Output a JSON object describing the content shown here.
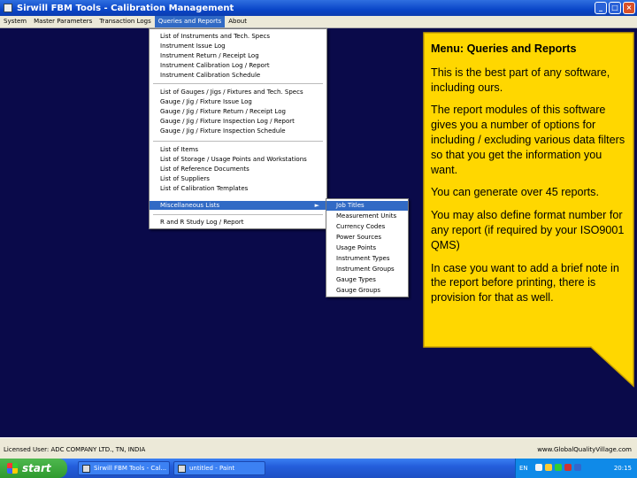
{
  "window": {
    "title": "Sirwill FBM Tools - Calibration Management",
    "minimize_label": "_",
    "maximize_label": "□",
    "close_label": "×"
  },
  "menubar": [
    {
      "label": "System"
    },
    {
      "label": "Master Parameters"
    },
    {
      "label": "Transaction Logs"
    },
    {
      "label": "Queries and Reports"
    },
    {
      "label": "About"
    }
  ],
  "queries_menu": {
    "items": [
      {
        "label": "List of Instruments and Tech. Specs"
      },
      {
        "label": "Instrument Issue Log"
      },
      {
        "label": "Instrument Return / Receipt Log"
      },
      {
        "label": "Instrument Calibration Log / Report"
      },
      {
        "label": "Instrument Calibration Schedule"
      },
      {
        "label": "List of Gauges / Jigs / Fixtures and Tech. Specs"
      },
      {
        "label": "Gauge / Jig / Fixture Issue Log"
      },
      {
        "label": "Gauge / Jig / Fixture Return / Receipt Log"
      },
      {
        "label": "Gauge / Jig / Fixture Inspection Log / Report"
      },
      {
        "label": "Gauge / Jig / Fixture Inspection Schedule"
      },
      {
        "label": "List of Items"
      },
      {
        "label": "List of Storage / Usage Points and Workstations"
      },
      {
        "label": "List of Reference Documents"
      },
      {
        "label": "List of Suppliers"
      },
      {
        "label": "List of Calibration Templates"
      },
      {
        "label": "Miscellaneous Lists",
        "submenu_arrow": "►"
      },
      {
        "label": "R and R Study Log / Report"
      }
    ]
  },
  "misc_submenu": {
    "items": [
      {
        "label": "Job Titles"
      },
      {
        "label": "Measurement Units"
      },
      {
        "label": "Currency Codes"
      },
      {
        "label": "Power Sources"
      },
      {
        "label": "Usage Points"
      },
      {
        "label": "Instrument Types"
      },
      {
        "label": "Instrument Groups"
      },
      {
        "label": "Gauge Types"
      },
      {
        "label": "Gauge Groups"
      }
    ]
  },
  "callout": {
    "title": "Menu: Queries and Reports",
    "paragraphs": [
      "This is the best part of any software, including ours.",
      "The report modules of this software gives you a number of options for including / excluding various data filters so that you get the information you want.",
      "You can generate over 45 reports.",
      "You may also define format number for any report (if required by your ISO9001 QMS)",
      "In case you want to add a brief note in the report before printing, there is provision for that as well."
    ],
    "fill_color": "#ffd700",
    "border_color": "#c8a000"
  },
  "statusbar": {
    "licensed_user": "Licensed User: ADC COMPANY LTD., TN, INDIA",
    "website": "www.GlobalQualityVillage.com"
  },
  "taskbar": {
    "start_label": "start",
    "tasks": [
      {
        "label": "Sirwill FBM Tools - Cal..."
      },
      {
        "label": "untitled - Paint"
      }
    ],
    "tray": {
      "language": "EN",
      "clock": "20:15"
    }
  }
}
